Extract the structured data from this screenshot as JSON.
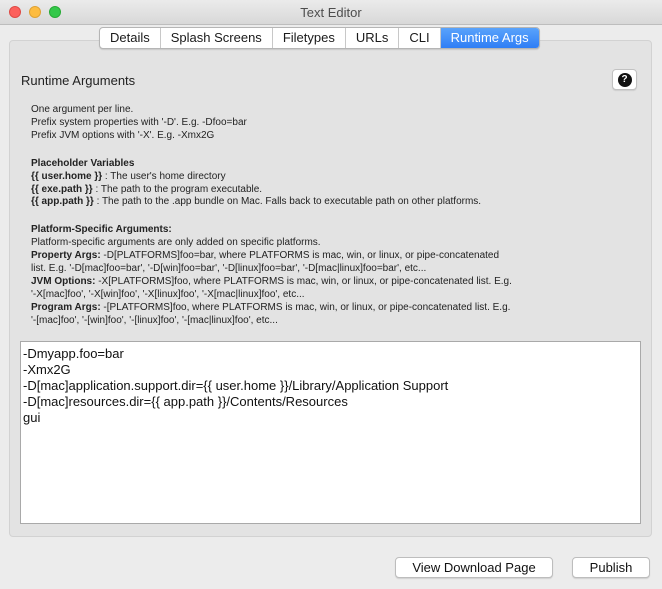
{
  "window": {
    "title": "Text Editor"
  },
  "tabs": [
    {
      "label": "Details",
      "active": false
    },
    {
      "label": "Splash Screens",
      "active": false
    },
    {
      "label": "Filetypes",
      "active": false
    },
    {
      "label": "URLs",
      "active": false
    },
    {
      "label": "CLI",
      "active": false
    },
    {
      "label": "Runtime Args",
      "active": true
    }
  ],
  "section": {
    "title": "Runtime Arguments",
    "help_label": "?"
  },
  "help": {
    "intro": [
      "One argument per line.",
      "Prefix system properties with '-D'. E.g. -Dfoo=bar",
      "Prefix JVM options with '-X'. E.g. -Xmx2G"
    ],
    "placeholder_title": "Placeholder Variables",
    "placeholders": [
      {
        "name": "{{ user.home }}",
        "desc": " : The user's home directory"
      },
      {
        "name": "{{ exe.path }}",
        "desc": " : The path to the program executable."
      },
      {
        "name": "{{ app.path }}",
        "desc": " : The path to the .app bundle on Mac. Falls back to executable path on other platforms."
      }
    ],
    "platform_title": "Platform-Specific Arguments:",
    "platform_intro": "Platform-specific arguments are only added on specific platforms.",
    "platform_items": [
      {
        "label": "Property Args:",
        "line1": " -D[PLATFORMS]foo=bar, where PLATFORMS is mac, win, or linux, or pipe-concatenated",
        "line2": "list. E.g. '-D[mac]foo=bar', '-D[win]foo=bar', '-D[linux]foo=bar', '-D[mac|linux]foo=bar', etc..."
      },
      {
        "label": "JVM Options:",
        "line1": " -X[PLATFORMS]foo, where PLATFORMS is mac, win, or linux, or pipe-concatenated list. E.g.",
        "line2": "'-X[mac]foo', '-X[win]foo', '-X[linux]foo', '-X[mac|linux]foo', etc..."
      },
      {
        "label": "Program Args:",
        "line1": " -[PLATFORMS]foo, where PLATFORMS is mac, win, or linux, or pipe-concatenated list. E.g.",
        "line2": "'-[mac]foo', '-[win]foo', '-[linux]foo', '-[mac|linux]foo', etc..."
      }
    ]
  },
  "editor": {
    "lines": [
      "-Dmyapp.foo=bar",
      "-Xmx2G",
      "-D[mac]application.support.dir={{ user.home }}/Library/Application Support",
      "-D[mac]resources.dir={{ app.path }}/Contents/Resources",
      "gui"
    ]
  },
  "buttons": {
    "download": "View Download Page",
    "publish": "Publish"
  },
  "colors": {
    "active_tab": "#3b87f7",
    "close": "#fc605c",
    "minimize": "#fdbc40",
    "maximize": "#34c84a"
  }
}
